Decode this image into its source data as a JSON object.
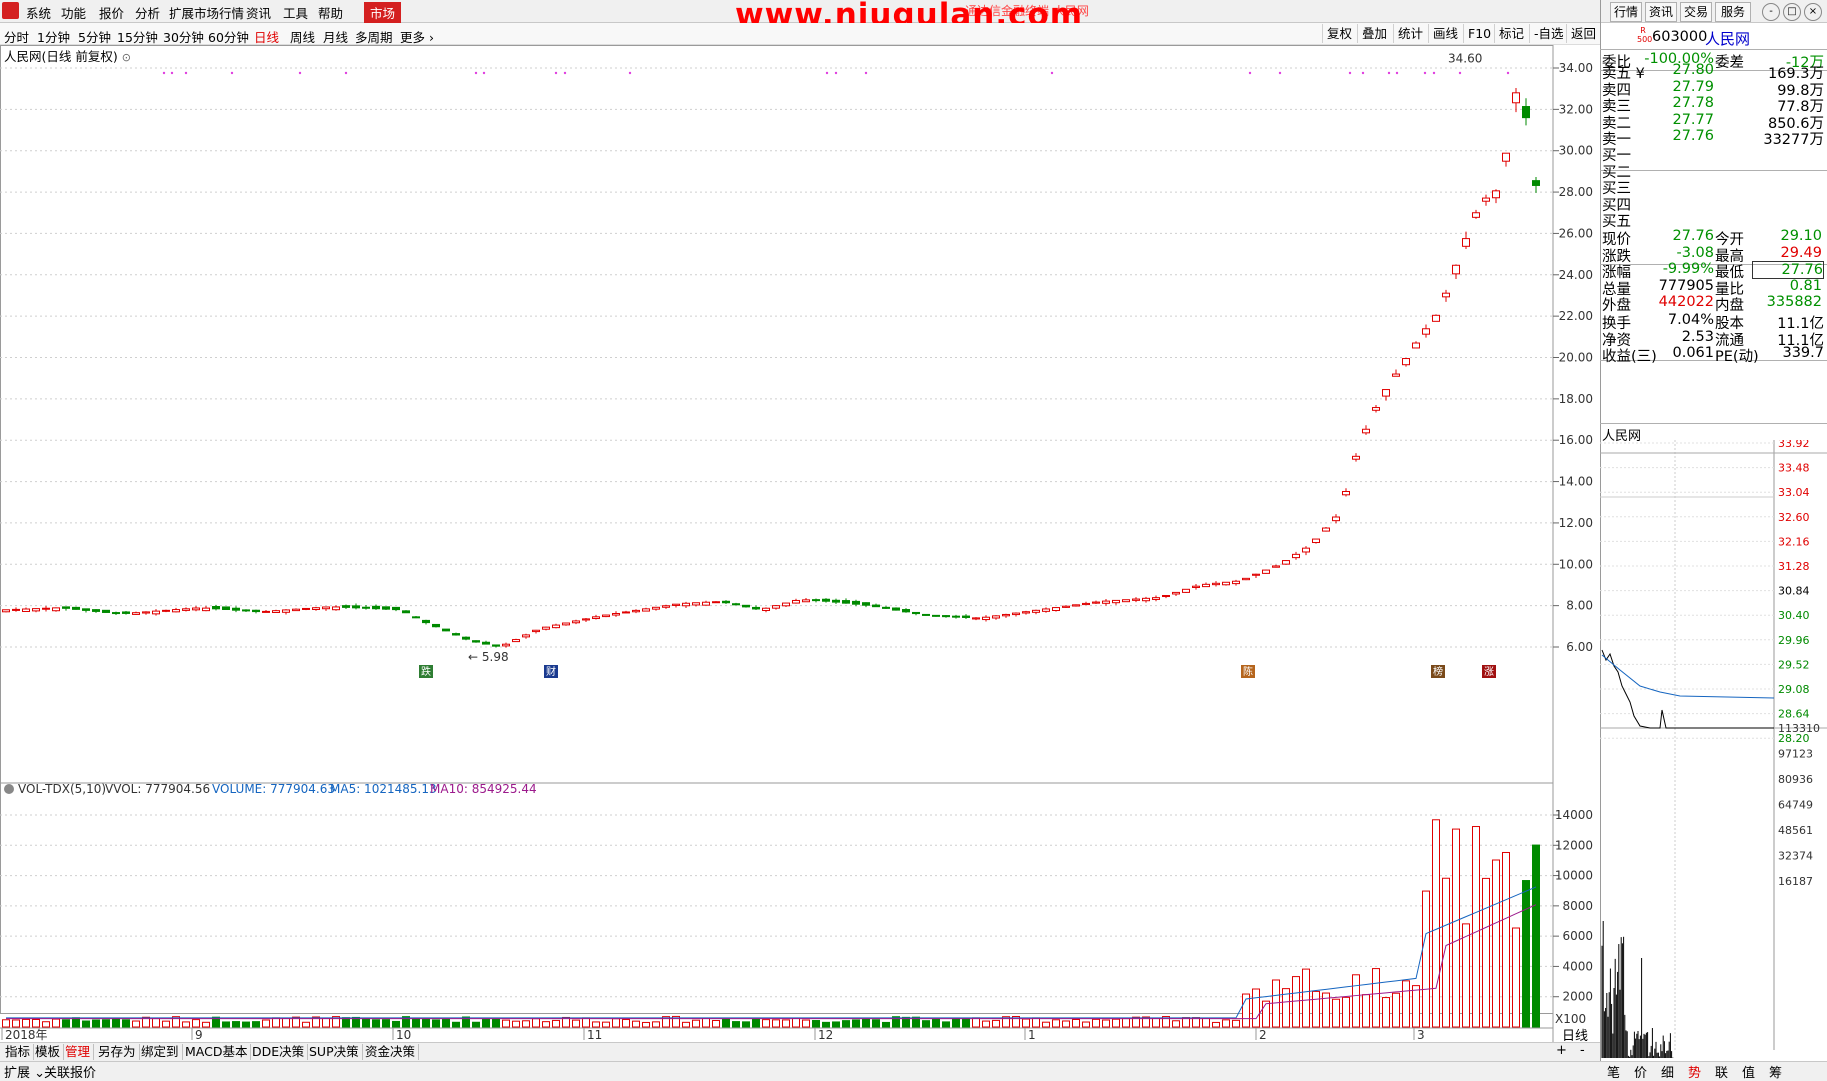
{
  "menu": {
    "items": [
      "系统",
      "功能",
      "报价",
      "分析",
      "扩展市场行情",
      "资讯",
      "工具",
      "帮助"
    ],
    "market": "市场",
    "watermark": "www.niugulan.com",
    "sub_watermark": "通达信金融终端 人民网",
    "right_buttons": [
      "行情",
      "资讯",
      "交易",
      "服务"
    ],
    "window_controls": [
      "-",
      "□",
      "×"
    ]
  },
  "periods": [
    "分时",
    "1分钟",
    "5分钟",
    "15分钟",
    "30分钟",
    "60分钟",
    "日线",
    "周线",
    "月线",
    "多周期",
    "更多"
  ],
  "active_period": "日线",
  "tools": [
    "复权",
    "叠加",
    "统计",
    "画线",
    "F10",
    "标记",
    "-自选",
    "返回"
  ],
  "chart": {
    "title": "人民网(日线 前复权)",
    "max_label": "34.60",
    "min_label": "5.98",
    "price_ticks": [
      "34.00",
      "32.00",
      "30.00",
      "28.00",
      "26.00",
      "24.00",
      "22.00",
      "20.00",
      "18.00",
      "16.00",
      "14.00",
      "12.00",
      "10.00",
      "8.00",
      "6.00"
    ],
    "vol_title": "VOL-TDX(5,10)",
    "vvol": "VVOL: 777904.56",
    "volume": "VOLUME: 777904.63",
    "ma5": "MA5: 1021485.13",
    "ma10": "MA10: 854925.44",
    "vol_ticks": [
      "14000",
      "12000",
      "10000",
      "8000",
      "6000",
      "4000",
      "2000"
    ],
    "vol_unit": "X100",
    "date_labels": [
      "2018年",
      "9",
      "10",
      "11",
      "12",
      "1",
      "2",
      "3"
    ],
    "period_label": "日线",
    "event_markers": [
      "跌",
      "财",
      "陈",
      "榜",
      "涨"
    ]
  },
  "quote": {
    "code": "603000",
    "name": "人民网",
    "code_badge_top": "R",
    "code_badge_bottom": "500",
    "weibi_label": "委比",
    "weibi": "-100.00%",
    "weicha_label": "委差",
    "weicha": "-12万",
    "asks": [
      {
        "label": "卖五",
        "price": "27.80",
        "vol": "169.3万"
      },
      {
        "label": "卖四",
        "price": "27.79",
        "vol": "99.8万"
      },
      {
        "label": "卖三",
        "price": "27.78",
        "vol": "77.8万"
      },
      {
        "label": "卖二",
        "price": "27.77",
        "vol": "850.6万"
      },
      {
        "label": "卖一",
        "price": "27.76",
        "vol": "33277万"
      }
    ],
    "bids": [
      "买一",
      "买二",
      "买三",
      "买四",
      "买五"
    ],
    "yen": "¥",
    "stats": [
      {
        "l1": "现价",
        "v1": "27.76",
        "l2": "今开",
        "v2": "29.10"
      },
      {
        "l1": "涨跌",
        "v1": "-3.08",
        "l2": "最高",
        "v2": "29.49"
      },
      {
        "l1": "涨幅",
        "v1": "-9.99%",
        "l2": "最低",
        "v2": "27.76"
      },
      {
        "l1": "总量",
        "v1": "777905",
        "l2": "量比",
        "v2": "0.81"
      },
      {
        "l1": "外盘",
        "v1": "442022",
        "l2": "内盘",
        "v2": "335882"
      }
    ],
    "stats2": [
      {
        "l1": "换手",
        "v1": "7.04%",
        "l2": "股本",
        "v2": "11.1亿"
      },
      {
        "l1": "净资",
        "v1": "2.53",
        "l2": "流通",
        "v2": "11.1亿"
      },
      {
        "l1": "收益(三)",
        "v1": "0.061",
        "l2": "PE(动)",
        "v2": "339.7"
      }
    ]
  },
  "mini_chart": {
    "name": "人民网",
    "price_ticks": [
      "33.92",
      "33.48",
      "33.04",
      "32.60",
      "32.16",
      "31.28",
      "30.84",
      "30.40",
      "29.96",
      "29.52",
      "29.08",
      "28.64",
      "28.20"
    ],
    "vol_ticks": [
      "113310",
      "97123",
      "80936",
      "64749",
      "48561",
      "32374",
      "16187"
    ]
  },
  "bottom_tabs": [
    "指标",
    "模板",
    "管理",
    "另存为",
    "绑定到",
    "MACD基本",
    "DDE决策",
    "SUP决策",
    "资金决策"
  ],
  "bottom_tabs2": [
    "扩展",
    "关联报价"
  ],
  "right_tabs": [
    "笔",
    "价",
    "细",
    "势",
    "联",
    "值",
    "筹"
  ],
  "colors": {
    "up": "#e00000",
    "down": "#008a00",
    "accent": "#d42020"
  }
}
